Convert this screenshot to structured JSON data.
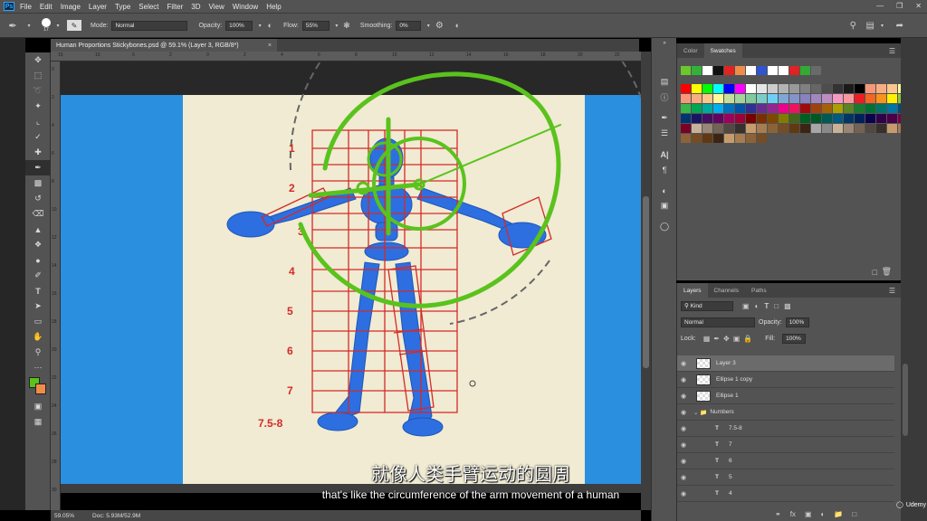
{
  "app": {
    "logo": "Ps"
  },
  "menu": [
    "File",
    "Edit",
    "Image",
    "Layer",
    "Type",
    "Select",
    "Filter",
    "3D",
    "View",
    "Window",
    "Help"
  ],
  "window_controls": [
    "minimize",
    "restore",
    "close"
  ],
  "options_bar": {
    "brush_size": "17",
    "mode_label": "Mode:",
    "mode_value": "Normal",
    "opacity_label": "Opacity:",
    "opacity_value": "100%",
    "flow_label": "Flow:",
    "flow_value": "55%",
    "smoothing_label": "Smoothing:",
    "smoothing_value": "0%"
  },
  "document_tab": {
    "title": "Human Proportions Stickybones.psd @ 59.1% (Layer 3, RGB/8*)",
    "close": "×"
  },
  "ruler_top_ticks": [
    "15",
    "10",
    "6",
    "2",
    "0",
    "2",
    "4",
    "6",
    "8",
    "10",
    "12",
    "14",
    "16",
    "18",
    "20",
    "22"
  ],
  "ruler_left_ticks": [
    "0",
    "2",
    "4",
    "6",
    "8",
    "10",
    "12",
    "14",
    "16",
    "18",
    "20",
    "22",
    "24",
    "26",
    "28",
    "30"
  ],
  "canvas": {
    "row_numbers": [
      "1",
      "2",
      "3",
      "4",
      "5",
      "6",
      "7",
      "7.5-8"
    ],
    "colors": {
      "photo_bg": "#2b8fe0",
      "paper": "#f0ebd2",
      "grid": "#d42a2a",
      "green": "#5ac21d",
      "figure": "#2d6fe0"
    }
  },
  "status": {
    "zoom": "59.05%",
    "doc": "Doc: 5.93M/52.9M"
  },
  "swatches_panel": {
    "tabs": [
      "Color",
      "Swatches"
    ],
    "recent": [
      "#6ac82b",
      "#32b23a",
      "#ffffff",
      "#111111",
      "#e32320",
      "#f08c4a",
      "#ffffff",
      "#2f55d4",
      "#ffffff",
      "#ffffff",
      "#e02222",
      "#33aa33",
      "#6a6a6a"
    ],
    "rows": [
      [
        "#ff0000",
        "#ffff00",
        "#00ff00",
        "#00ffff",
        "#0000ff",
        "#ff00ff",
        "#ffffff",
        "#e6e6e6",
        "#cccccc",
        "#b3b3b3",
        "#999999",
        "#808080",
        "#666666",
        "#4d4d4d",
        "#333333",
        "#1a1a1a",
        "#000000",
        "#f7977a",
        "#fbad82",
        "#fdc68c",
        "#fff79a"
      ],
      [
        "#f7977a",
        "#f9ad81",
        "#fdc68a",
        "#fff79a",
        "#c4df9b",
        "#a2d39c",
        "#82ca9d",
        "#7bcdc8",
        "#6ecff6",
        "#7ea7d8",
        "#8493ca",
        "#8882be",
        "#a187be",
        "#bc8dbf",
        "#f49ac2",
        "#f6989d",
        "#ed1c24",
        "#f26522",
        "#f7941d",
        "#fff200",
        "#8dc63f"
      ],
      [
        "#39b54a",
        "#00a651",
        "#00a99d",
        "#00aeef",
        "#0072bc",
        "#0054a6",
        "#2e3192",
        "#662d91",
        "#92278f",
        "#ec008c",
        "#ed145b",
        "#9e0b0f",
        "#a0410d",
        "#a36209",
        "#aba000",
        "#598527",
        "#1a7b30",
        "#007236",
        "#00746b",
        "#0076a3",
        "#004b80"
      ],
      [
        "#003471",
        "#1b1464",
        "#440e62",
        "#630460",
        "#9e005d",
        "#9e0039",
        "#790000",
        "#7b2e00",
        "#7d4900",
        "#827b00",
        "#406618",
        "#005e20",
        "#005826",
        "#005952",
        "#005b7f",
        "#003663",
        "#002157",
        "#0d004c",
        "#32004b",
        "#4b0049",
        "#7b0046"
      ],
      [
        "#7a0026",
        "#c7b299",
        "#998675",
        "#736357",
        "#534741",
        "#37302d",
        "#c69c6d",
        "#a67c52",
        "#8c6239",
        "#754c24",
        "#603913",
        "#3c2415",
        "#a6a6a6",
        "#898989",
        "#c7b299",
        "#998675",
        "#736357",
        "#534741",
        "#37302d",
        "#c69c6d",
        "#a67c52"
      ],
      [
        "#8c6239",
        "#754c24",
        "#603913",
        "#3c2415",
        "#c69c6d",
        "#a67c52",
        "#8c6239",
        "#754c24"
      ]
    ]
  },
  "layers_panel": {
    "tabs": [
      "Layers",
      "Channels",
      "Paths"
    ],
    "kind_label": "Kind",
    "blend_mode": "Normal",
    "opacity_label": "Opacity:",
    "opacity_value": "100%",
    "lock_label": "Lock:",
    "fill_label": "Fill:",
    "fill_value": "100%",
    "layers": [
      {
        "name": "Layer 3",
        "type": "pixel",
        "selected": true
      },
      {
        "name": "Ellipse 1 copy",
        "type": "shape",
        "selected": false
      },
      {
        "name": "Ellipse 1",
        "type": "shape",
        "selected": false
      },
      {
        "name": "Numbers",
        "type": "group",
        "selected": false
      },
      {
        "name": "7.5-8",
        "type": "text",
        "selected": false
      },
      {
        "name": "7",
        "type": "text",
        "selected": false
      },
      {
        "name": "6",
        "type": "text",
        "selected": false
      },
      {
        "name": "5",
        "type": "text",
        "selected": false
      },
      {
        "name": "4",
        "type": "text",
        "selected": false
      }
    ]
  },
  "subtitles": {
    "cn": "就像人类手臂运动的圆周",
    "en": "that's like the circumference of the arm movement of a human"
  },
  "watermark": {
    "text": "Udemy"
  }
}
